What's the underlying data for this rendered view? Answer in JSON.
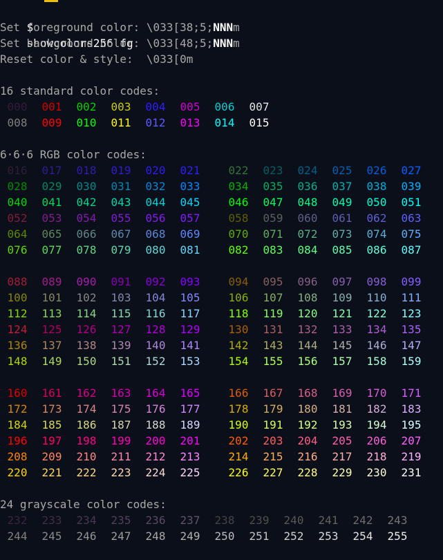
{
  "prompt": {
    "symbol": "$",
    "command": "showcolors256 fg"
  },
  "help": {
    "fg": {
      "prefix": "Set foreground color: \\033[38;5;",
      "nnn": "NNN",
      "suffix": "m"
    },
    "bg": {
      "prefix": "Set background color: \\033[48;5;",
      "nnn": "NNN",
      "suffix": "m"
    },
    "reset": "Reset color & style:  \\033[0m"
  },
  "headings": {
    "standard": "16 standard color codes:",
    "rgb": "6·6·6 RGB color codes:",
    "grayscale": "24 grayscale color codes:"
  },
  "colors": {
    "default_text": "#d0d0d0",
    "background": "#0b0f19",
    "accent": "#f0c000"
  }
}
